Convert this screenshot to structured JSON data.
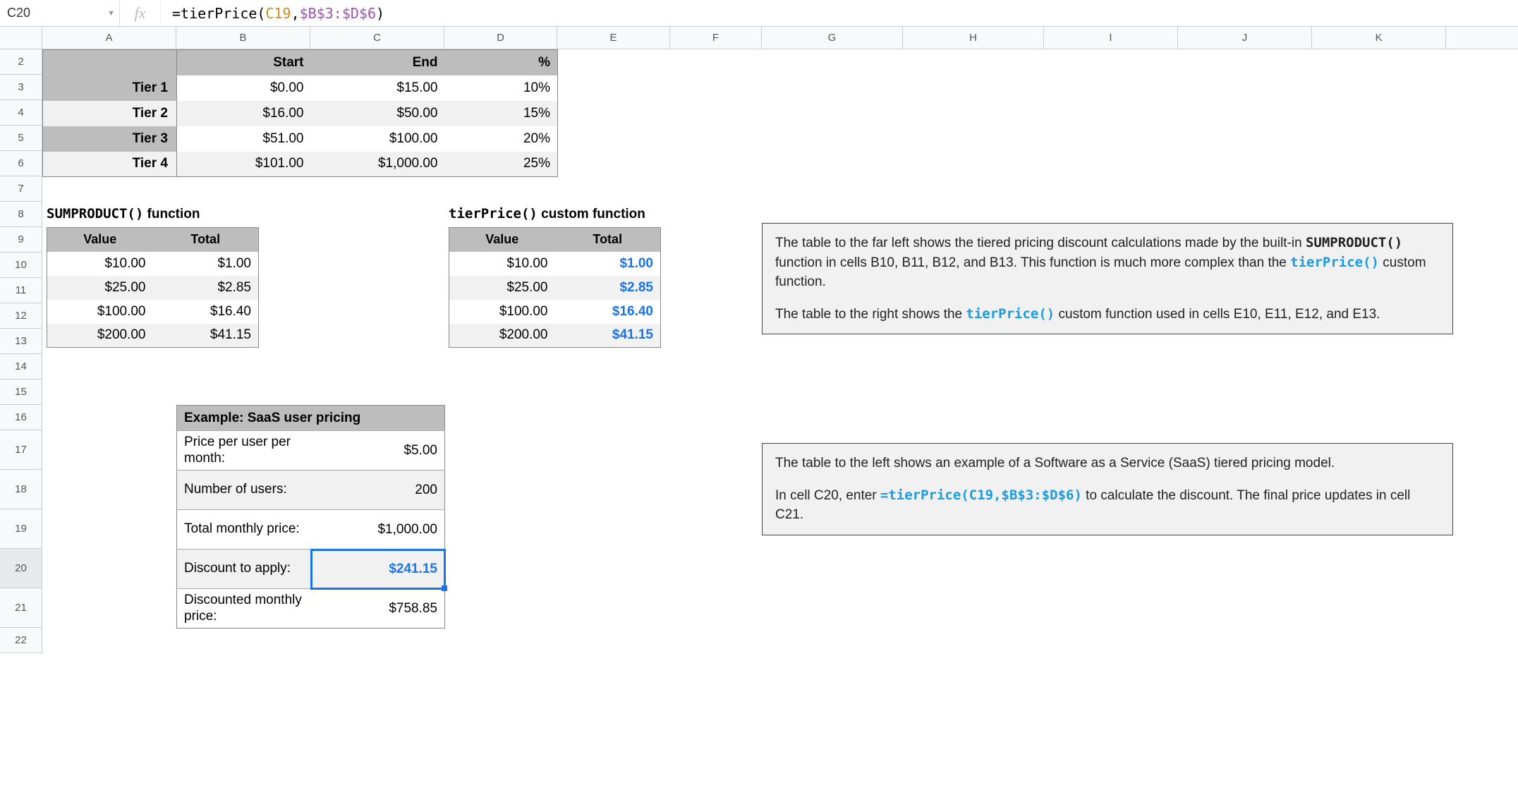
{
  "activeCell": "C20",
  "formula": {
    "prefix": "=",
    "fn": "tierPrice",
    "open": "(",
    "arg1": "C19",
    "comma": ",",
    "arg2": "$B$3:$D$6",
    "close": ")"
  },
  "columns": [
    "A",
    "B",
    "C",
    "D",
    "E",
    "F",
    "G",
    "H",
    "I",
    "J",
    "K"
  ],
  "rows": [
    "2",
    "3",
    "4",
    "5",
    "6",
    "7",
    "8",
    "9",
    "10",
    "11",
    "12",
    "13",
    "14",
    "15",
    "16",
    "17",
    "18",
    "19",
    "20",
    "21",
    "22"
  ],
  "tier": {
    "head": {
      "start": "Start",
      "end": "End",
      "pct": "%"
    },
    "rows": [
      {
        "name": "Tier 1",
        "start": "$0.00",
        "end": "$15.00",
        "pct": "10%"
      },
      {
        "name": "Tier 2",
        "start": "$16.00",
        "end": "$50.00",
        "pct": "15%"
      },
      {
        "name": "Tier 3",
        "start": "$51.00",
        "end": "$100.00",
        "pct": "20%"
      },
      {
        "name": "Tier 4",
        "start": "$101.00",
        "end": "$1,000.00",
        "pct": "25%"
      }
    ]
  },
  "sumproduct": {
    "titleFn": "SUMPRODUCT()",
    "titleWord": " function",
    "head": {
      "value": "Value",
      "total": "Total"
    },
    "rows": [
      {
        "value": "$10.00",
        "total": "$1.00"
      },
      {
        "value": "$25.00",
        "total": "$2.85"
      },
      {
        "value": "$100.00",
        "total": "$16.40"
      },
      {
        "value": "$200.00",
        "total": "$41.15"
      }
    ]
  },
  "tierprice": {
    "titleFn": "tierPrice()",
    "titleWord": " custom function",
    "head": {
      "value": "Value",
      "total": "Total"
    },
    "rows": [
      {
        "value": "$10.00",
        "total": "$1.00"
      },
      {
        "value": "$25.00",
        "total": "$2.85"
      },
      {
        "value": "$100.00",
        "total": "$16.40"
      },
      {
        "value": "$200.00",
        "total": "$41.15"
      }
    ]
  },
  "saas": {
    "title": "Example: SaaS user pricing",
    "rows": {
      "ppu": {
        "label": "Price per user per month:",
        "value": "$5.00"
      },
      "users": {
        "label": "Number of users:",
        "value": "200"
      },
      "total": {
        "label": "Total monthly price:",
        "value": "$1,000.00"
      },
      "disc": {
        "label": "Discount to apply:",
        "value": "$241.15"
      },
      "final": {
        "label": "Discounted monthly price:",
        "value": "$758.85"
      }
    }
  },
  "note1": {
    "p1a": "The table to the far left shows the tiered pricing discount calculations made by the built-in ",
    "p1fn1": "SUMPRODUCT()",
    "p1b": " function in cells B10, B11, B12, and B13. This function is much more complex than the ",
    "p1fn2": "tierPrice()",
    "p1c": " custom function.",
    "p2a": "The table to the right shows the ",
    "p2fn": "tierPrice()",
    "p2b": " custom function used in cells E10, E11, E12, and E13."
  },
  "note2": {
    "p1": "The table to the left shows an example of a Software as a Service (SaaS) tiered pricing model.",
    "p2a": "In cell C20, enter ",
    "p2code": "=tierPrice(C19,$B$3:$D$6)",
    "p2b": " to calculate the discount. The final price updates in cell C21."
  }
}
